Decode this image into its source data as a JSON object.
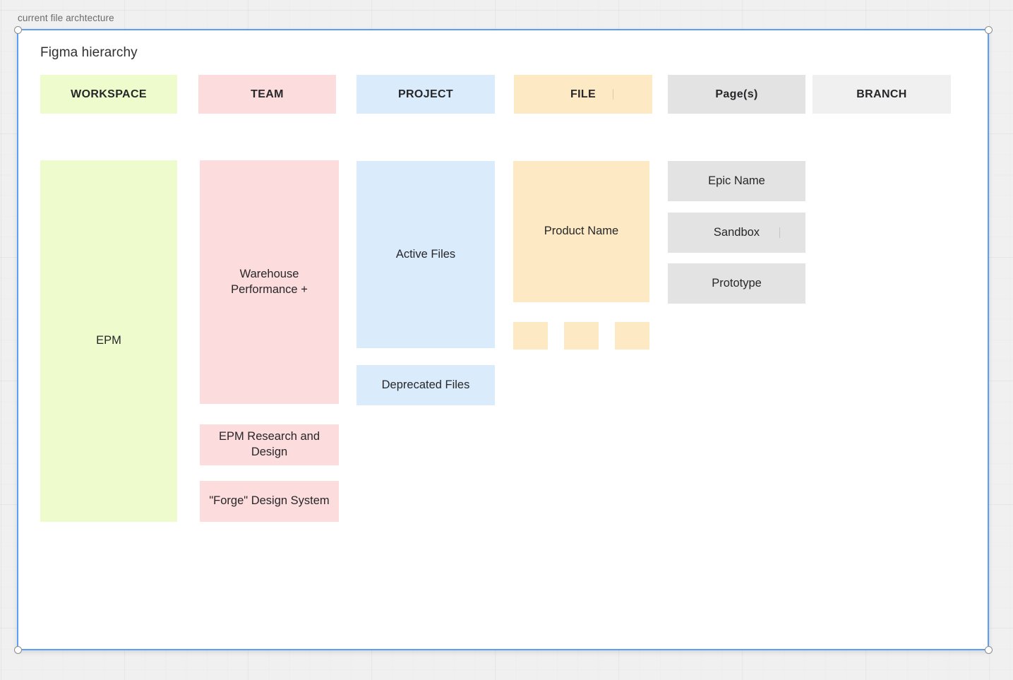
{
  "canvas": {
    "background_color": "#f0f0f0",
    "grid": "on"
  },
  "frame": {
    "label": "current file archtecture",
    "selected": true,
    "selection_color": "#5a9ef6",
    "background_color": "#ffffff"
  },
  "diagram": {
    "title": "Figma hierarchy",
    "palette": {
      "workspace": "#eefccd",
      "team": "#fcdcdc",
      "project": "#daebfc",
      "file": "#fdeac4",
      "pages": "#e3e3e3",
      "branch": "#f0f0f0"
    },
    "headers": [
      {
        "label": "WORKSPACE",
        "color": "#eefccd"
      },
      {
        "label": "TEAM",
        "color": "#fcdcdc"
      },
      {
        "label": "PROJECT",
        "color": "#daebfc"
      },
      {
        "label": "FILE",
        "color": "#fdeac4"
      },
      {
        "label": "Page(s)",
        "color": "#e3e3e3"
      },
      {
        "label": "BRANCH",
        "color": "#f0f0f0"
      }
    ],
    "workspace_items": [
      {
        "label": "EPM",
        "color": "#eefccd"
      }
    ],
    "team_items": [
      {
        "label": "Warehouse Performance +",
        "color": "#fcdcdc"
      },
      {
        "label": "EPM Research and Design",
        "color": "#fcdcdc"
      },
      {
        "label": "\"Forge\" Design System",
        "color": "#fcdcdc"
      }
    ],
    "project_items": [
      {
        "label": "Active Files",
        "color": "#daebfc"
      },
      {
        "label": "Deprecated Files",
        "color": "#daebfc"
      }
    ],
    "file_items": [
      {
        "label": "Product Name",
        "color": "#fdeac4"
      }
    ],
    "file_swatches": [
      {
        "label": "",
        "color": "#fdeac4"
      },
      {
        "label": "",
        "color": "#fdeac4"
      },
      {
        "label": "",
        "color": "#fdeac4"
      }
    ],
    "page_items": [
      {
        "label": "Epic Name",
        "color": "#e3e3e3"
      },
      {
        "label": "Sandbox",
        "color": "#e3e3e3"
      },
      {
        "label": "Prototype",
        "color": "#e3e3e3"
      }
    ],
    "branch_items": []
  }
}
